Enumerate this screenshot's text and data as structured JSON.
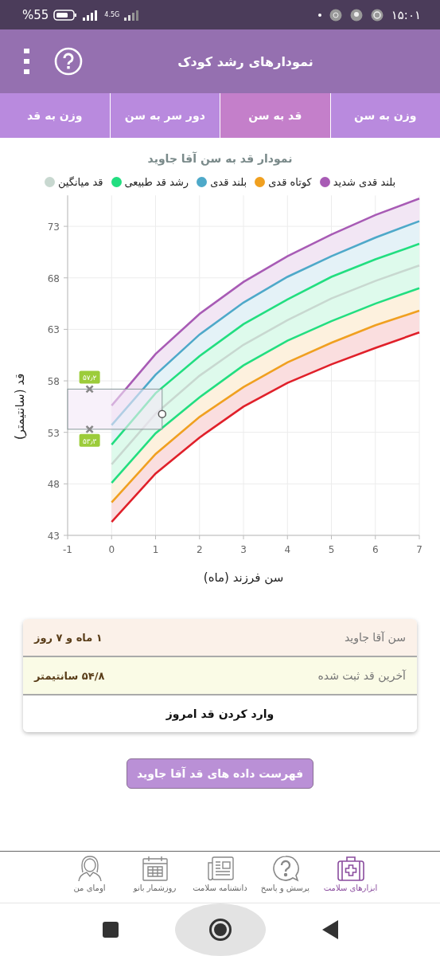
{
  "status_bar": {
    "time": "۱۵:۰۱",
    "network": "4.5G",
    "battery": "%55"
  },
  "header": {
    "title": "نمودارهای رشد کودک"
  },
  "tabs": [
    {
      "label": "وزن به سن",
      "selected": false
    },
    {
      "label": "قد به سن",
      "selected": true
    },
    {
      "label": "دور سر به سن",
      "selected": false
    },
    {
      "label": "وزن به قد",
      "selected": false
    }
  ],
  "chart_title": "نمودار قد به سن آقا جاوید",
  "chart": {
    "chart_data": {
      "type": "area",
      "grid": true,
      "xlabel": "سن فرزند (ماه)",
      "ylabel": "قد (سانتیمتر)",
      "x": [
        0,
        1,
        2,
        3,
        4,
        5,
        6,
        7
      ],
      "xlim": [
        -1,
        7
      ],
      "ylim": [
        43,
        76
      ],
      "xticks": [
        -1,
        0,
        1,
        2,
        3,
        4,
        5,
        6,
        7
      ],
      "yticks": [
        43,
        48,
        53,
        58,
        63,
        68,
        73
      ],
      "series": [
        {
          "name": "بلند قدی شدید",
          "color": "#a85bb5",
          "values": [
            55.6,
            60.6,
            64.5,
            67.6,
            70.1,
            72.2,
            74.1,
            75.7
          ]
        },
        {
          "name": "کوتاه قدی",
          "color": "#f0a020",
          "values": [
            46.2,
            50.9,
            54.5,
            57.4,
            59.8,
            61.7,
            63.4,
            64.8
          ]
        },
        {
          "name": "بلند قدی",
          "color": "#4ea9c9",
          "values": [
            53.7,
            58.6,
            62.5,
            65.6,
            68.1,
            70.1,
            71.9,
            73.5
          ]
        },
        {
          "name": "رشد قد طبیعی",
          "color": "#22de80",
          "values": [
            51.8,
            56.8,
            60.4,
            63.5,
            65.9,
            68.1,
            69.8,
            71.3
          ]
        },
        {
          "name": "قد میانگین",
          "type": "line",
          "color": "#c8d8d0",
          "values": [
            49.9,
            54.8,
            58.5,
            61.5,
            63.9,
            66.0,
            67.7,
            69.2
          ]
        },
        {
          "type": "line",
          "color": "#22de80",
          "values": [
            48.1,
            52.9,
            56.4,
            59.5,
            61.9,
            63.8,
            65.5,
            67.0
          ]
        },
        {
          "type": "line",
          "color": "#e0202a",
          "values": [
            44.3,
            49.0,
            52.5,
            55.5,
            57.8,
            59.6,
            61.2,
            62.7
          ]
        }
      ],
      "legend": true,
      "annotations": [
        "۵۷٫۲",
        "۵۳٫۳"
      ]
    }
  },
  "info_card": {
    "rows": [
      {
        "label": "سن آقا جاوید",
        "value": "۱ ماه و ۷ روز"
      },
      {
        "label": "آخرین قد ثبت شده",
        "value": "۵۴/۸ سانتیمتر"
      }
    ],
    "action": "وارد کردن قد امروز"
  },
  "list_button": "فهرست داده های قد آقا جاوید",
  "bottom_nav": [
    {
      "label": "ابزارهای سلامت",
      "kind": "kit",
      "selected": true
    },
    {
      "label": "پرسش و پاسخ",
      "kind": "question",
      "selected": false
    },
    {
      "label": "دانشنامه سلامت",
      "kind": "news",
      "selected": false
    },
    {
      "label": "روزشمار بانو",
      "kind": "calendar",
      "selected": false
    },
    {
      "label": "اومای من",
      "kind": "person",
      "selected": false
    }
  ]
}
